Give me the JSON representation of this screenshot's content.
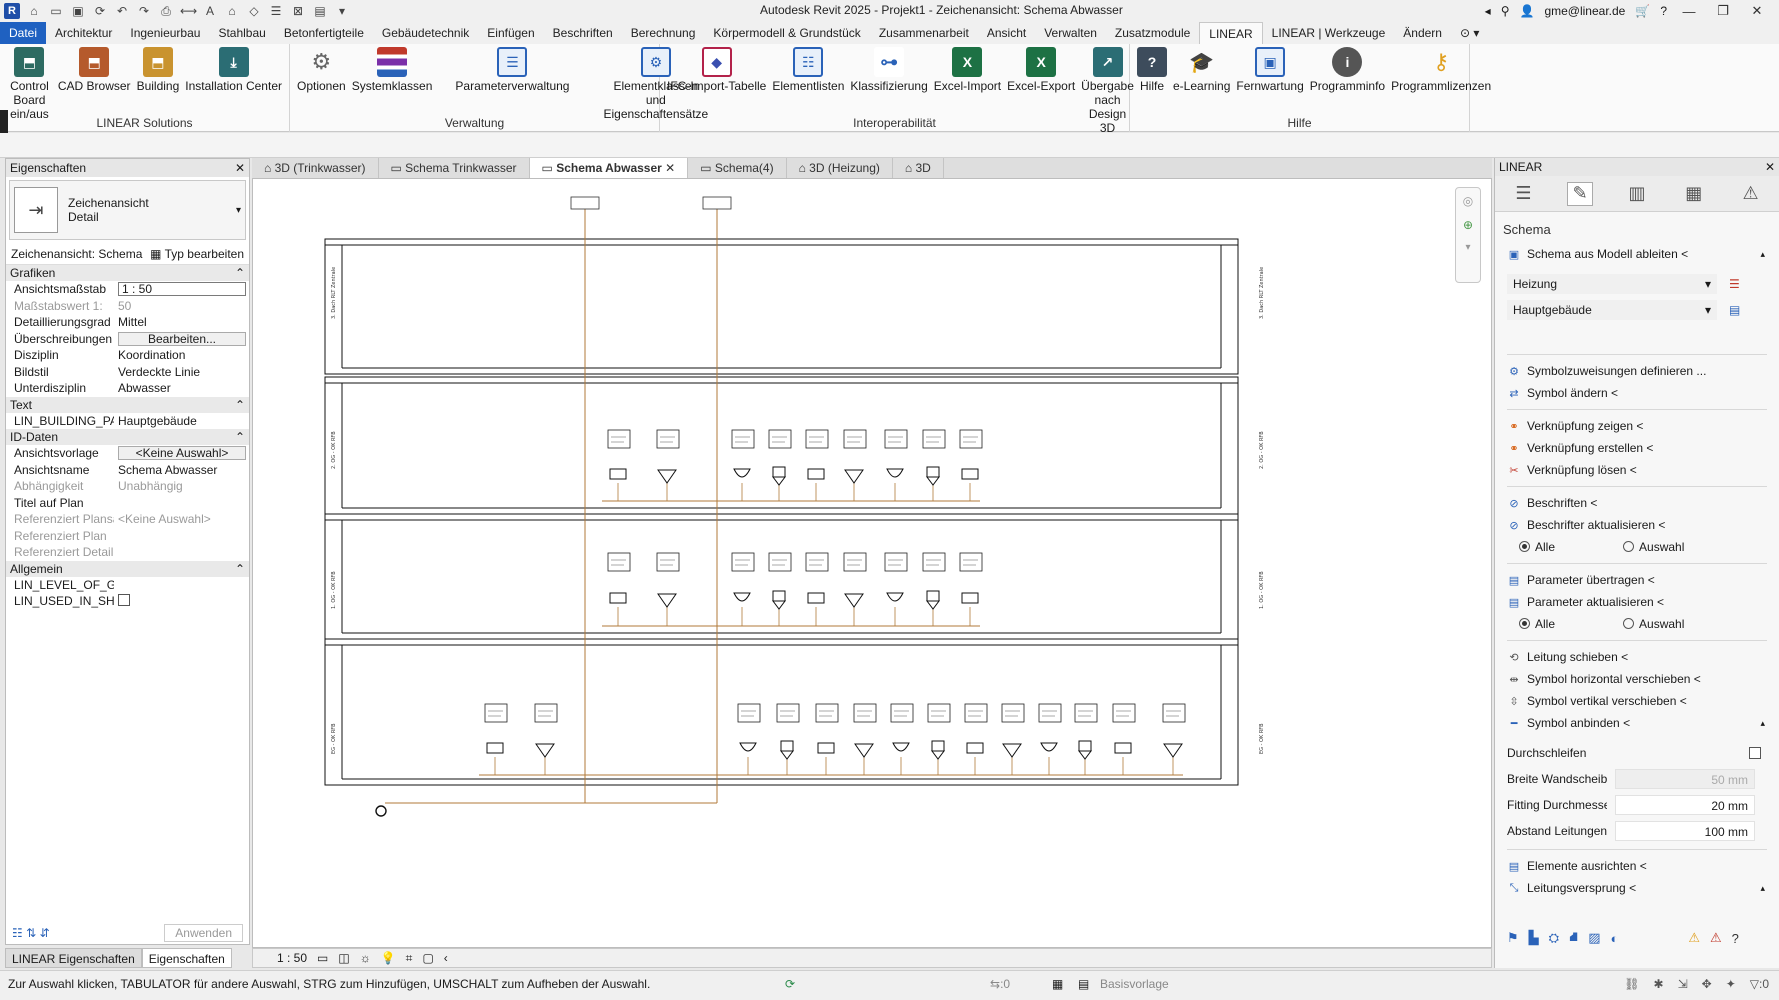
{
  "window": {
    "title": "Autodesk Revit 2025 - Projekt1 - Zeichenansicht: Schema Abwasser",
    "user": "gme@linear.de",
    "app_logo": "R"
  },
  "menu": {
    "tabs": [
      "Datei",
      "Architektur",
      "Ingenieurbau",
      "Stahlbau",
      "Betonfertigteile",
      "Gebäudetechnik",
      "Einfügen",
      "Beschriften",
      "Berechnung",
      "Körpermodell & Grundstück",
      "Zusammenarbeit",
      "Ansicht",
      "Verwalten",
      "Zusatzmodule",
      "LINEAR",
      "LINEAR | Werkzeuge",
      "Ändern"
    ]
  },
  "ribbon": {
    "groups": [
      {
        "label": "LINEAR Solutions",
        "buttons": [
          "Control Board\nein/aus",
          "CAD Browser",
          "Building",
          "Installation Center"
        ]
      },
      {
        "label": "Verwaltung",
        "buttons": [
          "Optionen",
          "Systemklassen",
          "Parameterverwaltung",
          "Elementklassen und\nEigenschaftensätze"
        ]
      },
      {
        "label": "Interoperabilität",
        "buttons": [
          "IFC-Import-Tabelle",
          "Elementlisten",
          "Klassifizierung",
          "Excel-Import",
          "Excel-Export",
          "Übergabe nach\nDesign 3D"
        ]
      },
      {
        "label": "Hilfe",
        "buttons": [
          "Hilfe",
          "e-Learning",
          "Fernwartung",
          "Programminfo",
          "Programmlizenzen"
        ]
      }
    ]
  },
  "properties": {
    "title": "Eigenschaften",
    "type_name": "Zeichenansicht",
    "type_sub": "Detail",
    "view_selector": "Zeichenansicht: Schema",
    "edit_type": "Typ bearbeiten",
    "cat_grafiken": "Grafiken",
    "rows_grafiken": [
      {
        "k": "Ansichtsmaßstab",
        "v": "1 : 50"
      },
      {
        "k": "Maßstabswert 1:",
        "v": "50"
      },
      {
        "k": "Detaillierungsgrad",
        "v": "Mittel"
      },
      {
        "k": "Überschreibungen S...",
        "v": "Bearbeiten..."
      },
      {
        "k": "Disziplin",
        "v": "Koordination"
      },
      {
        "k": "Bildstil",
        "v": "Verdeckte Linie"
      },
      {
        "k": "Unterdisziplin",
        "v": "Abwasser"
      }
    ],
    "cat_text": "Text",
    "rows_text": [
      {
        "k": "LIN_BUILDING_PART",
        "v": "Hauptgebäude"
      }
    ],
    "cat_id": "ID-Daten",
    "rows_id": [
      {
        "k": "Ansichtsvorlage",
        "v": "<Keine Auswahl>"
      },
      {
        "k": "Ansichtsname",
        "v": "Schema Abwasser"
      },
      {
        "k": "Abhängigkeit",
        "v": "Unabhängig"
      },
      {
        "k": "Titel auf Plan",
        "v": ""
      },
      {
        "k": "Referenziert Plansa...",
        "v": "<Keine Auswahl>"
      },
      {
        "k": "Referenziert Plan",
        "v": ""
      },
      {
        "k": "Referenziert Detail",
        "v": ""
      }
    ],
    "cat_allg": "Allgemein",
    "rows_allg": [
      {
        "k": "LIN_LEVEL_OF_GEO...",
        "v": ""
      },
      {
        "k": "LIN_USED_IN_SHEETS",
        "v": ""
      }
    ],
    "apply": "Anwenden"
  },
  "left_tabs": [
    "LINEAR Eigenschaften",
    "Eigenschaften"
  ],
  "view_tabs": [
    "3D (Trinkwasser)",
    "Schema Trinkwasser",
    "Schema Abwasser",
    "Schema(4)",
    "3D (Heizung)",
    "3D"
  ],
  "view_scale": "1 : 50",
  "drawing": {
    "floor_labels": [
      "3. Dach RLT Zentrale",
      "2. OG - OK RFB",
      "1. OG - OK RFB",
      "EG - OK RFB"
    ]
  },
  "linear_panel": {
    "title": "LINEAR",
    "section": "Schema",
    "derive": "Schema aus Modell ableiten <",
    "dd_system": "Heizung",
    "dd_building": "Hauptgebäude",
    "items1": [
      "Symbolzuweisungen definieren ...",
      "Symbol ändern <"
    ],
    "items2": [
      "Verknüpfung zeigen <",
      "Verknüpfung erstellen <",
      "Verknüpfung lösen <"
    ],
    "items3": [
      "Beschriften <",
      "Beschrifter aktualisieren <"
    ],
    "radio_all": "Alle",
    "radio_sel": "Auswahl",
    "items4": [
      "Parameter übertragen <",
      "Parameter aktualisieren <"
    ],
    "items5": [
      "Leitung schieben <",
      "Symbol horizontal verschieben <",
      "Symbol vertikal verschieben <",
      "Symbol anbinden <"
    ],
    "loop_label": "Durchschleifen",
    "fields": [
      {
        "k": "Breite Wandscheib",
        "v": "50 mm",
        "disabled": true
      },
      {
        "k": "Fitting Durchmesse",
        "v": "20 mm",
        "disabled": false
      },
      {
        "k": "Abstand Leitungen",
        "v": "100 mm",
        "disabled": false
      }
    ],
    "items6": [
      "Elemente ausrichten <",
      "Leitungsversprung <"
    ]
  },
  "status": {
    "text": "Zur Auswahl klicken, TABULATOR für andere Auswahl, STRG zum Hinzufügen, UMSCHALT zum Aufheben der Auswahl.",
    "zero1": ":0",
    "base_template": "Basisvorlage",
    "zero2": ":0"
  }
}
